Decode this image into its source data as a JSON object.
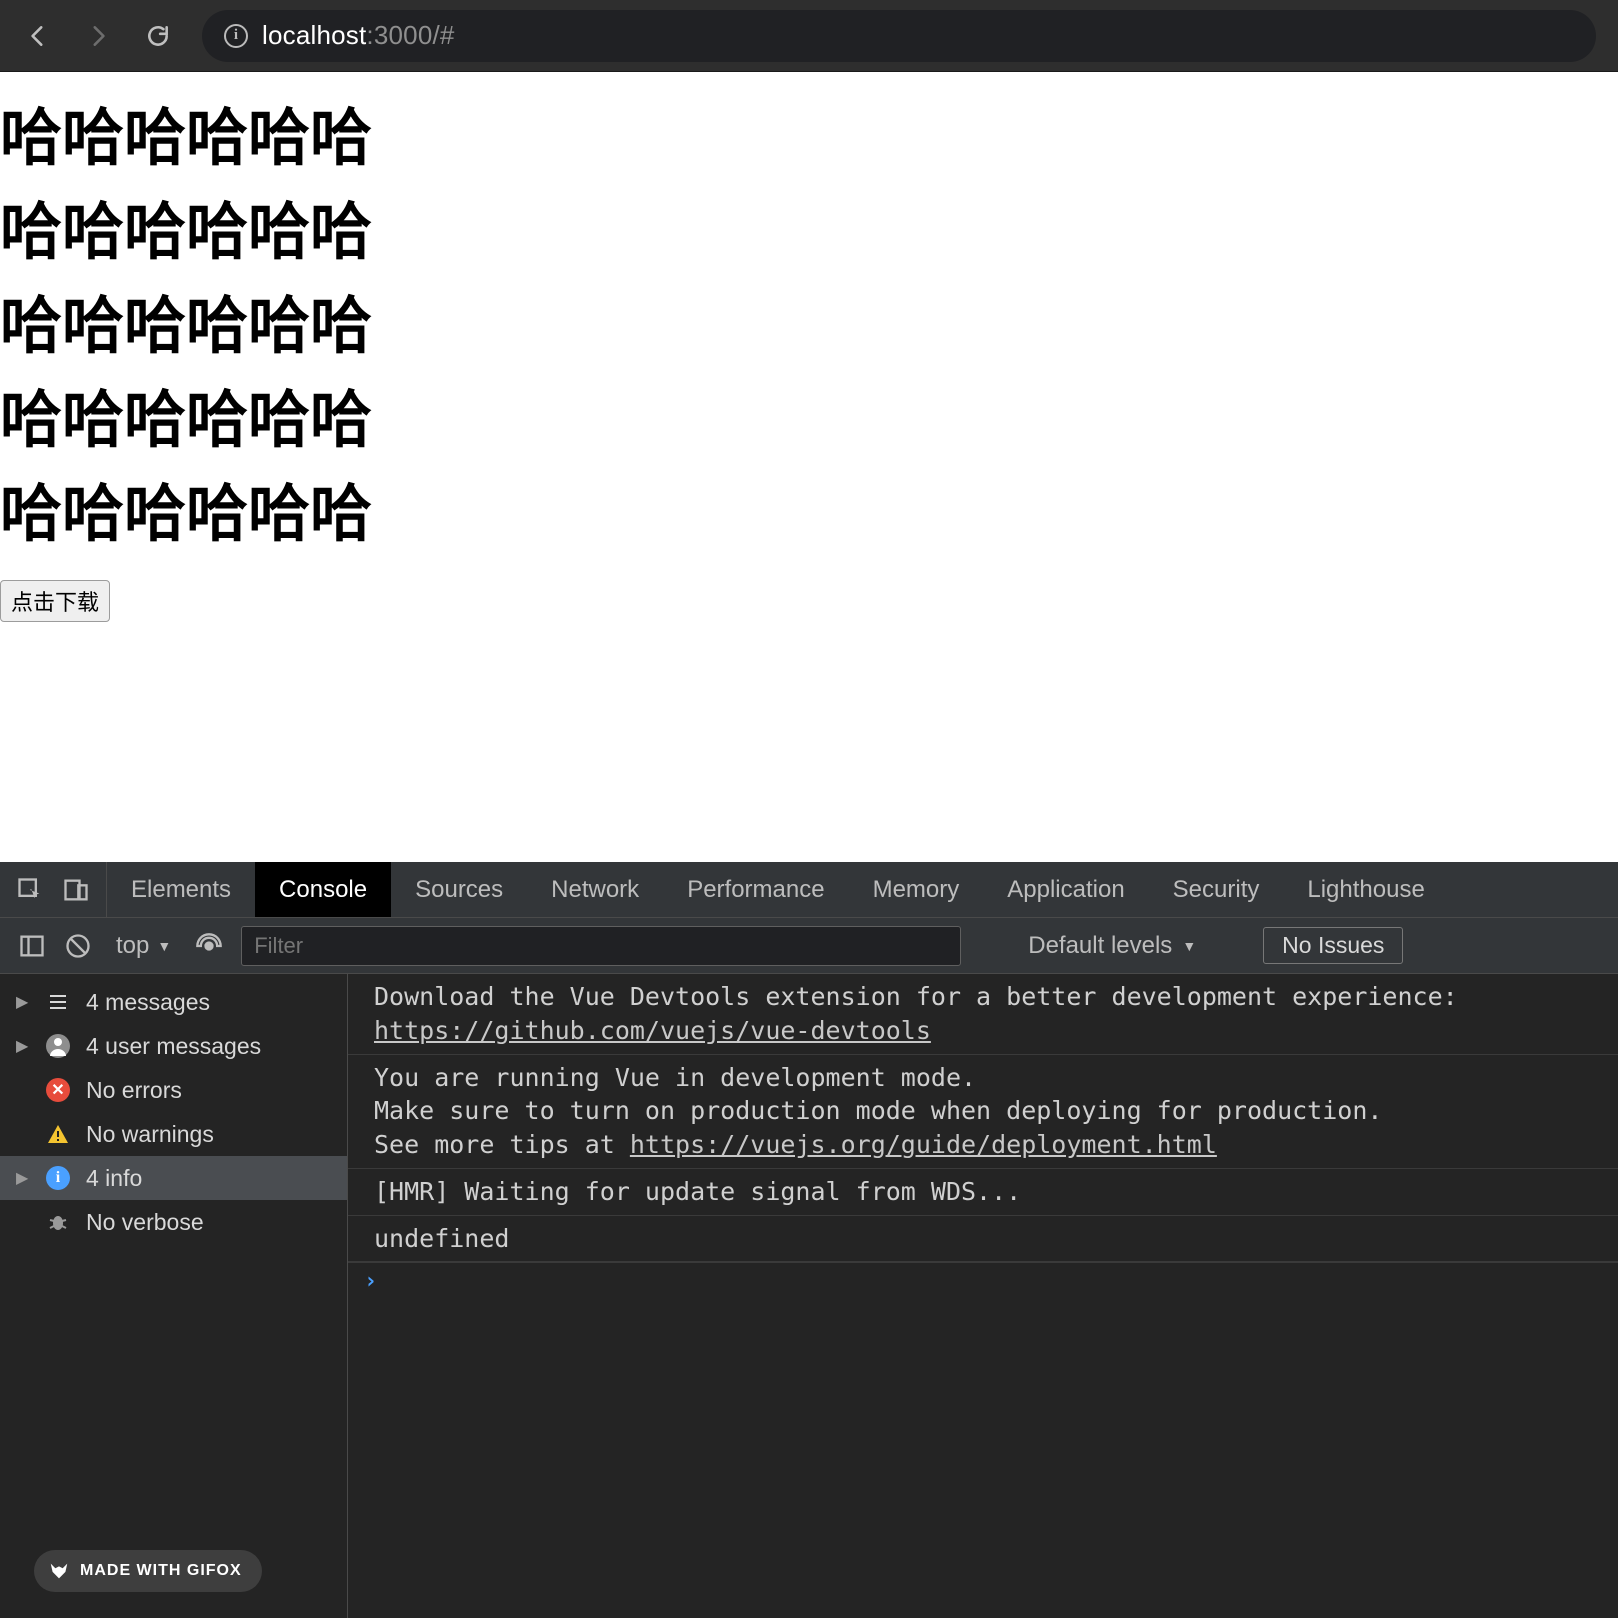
{
  "browser": {
    "url_host": "localhost",
    "url_port": ":3000",
    "url_path": "/#"
  },
  "page": {
    "rows": [
      "哈哈哈哈哈哈",
      "哈哈哈哈哈哈",
      "哈哈哈哈哈哈",
      "哈哈哈哈哈哈",
      "哈哈哈哈哈哈"
    ],
    "download_button": "点击下载"
  },
  "devtools": {
    "tabs": [
      "Elements",
      "Console",
      "Sources",
      "Network",
      "Performance",
      "Memory",
      "Application",
      "Security",
      "Lighthouse"
    ],
    "active_tab": "Console",
    "console_toolbar": {
      "context": "top",
      "filter_placeholder": "Filter",
      "levels": "Default levels",
      "issues_button": "No Issues"
    },
    "sidebar": {
      "items": [
        {
          "label": "4 messages",
          "icon": "list",
          "expandable": true
        },
        {
          "label": "4 user messages",
          "icon": "user",
          "expandable": true
        },
        {
          "label": "No errors",
          "icon": "error",
          "expandable": false
        },
        {
          "label": "No warnings",
          "icon": "warn",
          "expandable": false
        },
        {
          "label": "4 info",
          "icon": "info",
          "expandable": true,
          "selected": true
        },
        {
          "label": "No verbose",
          "icon": "bug",
          "expandable": false
        }
      ]
    },
    "gifox_label": "MADE WITH GIFOX",
    "output": {
      "line1a": "Download the Vue Devtools extension for a better development experience:",
      "line1b": "https://github.com/vuejs/vue-devtools",
      "line2a": "You are running Vue in development mode.",
      "line2b": "Make sure to turn on production mode when deploying for production.",
      "line2c_prefix": "See more tips at ",
      "line2c_link": "https://vuejs.org/guide/deployment.html",
      "line3": "[HMR] Waiting for update signal from WDS...",
      "line4": "undefined"
    }
  }
}
